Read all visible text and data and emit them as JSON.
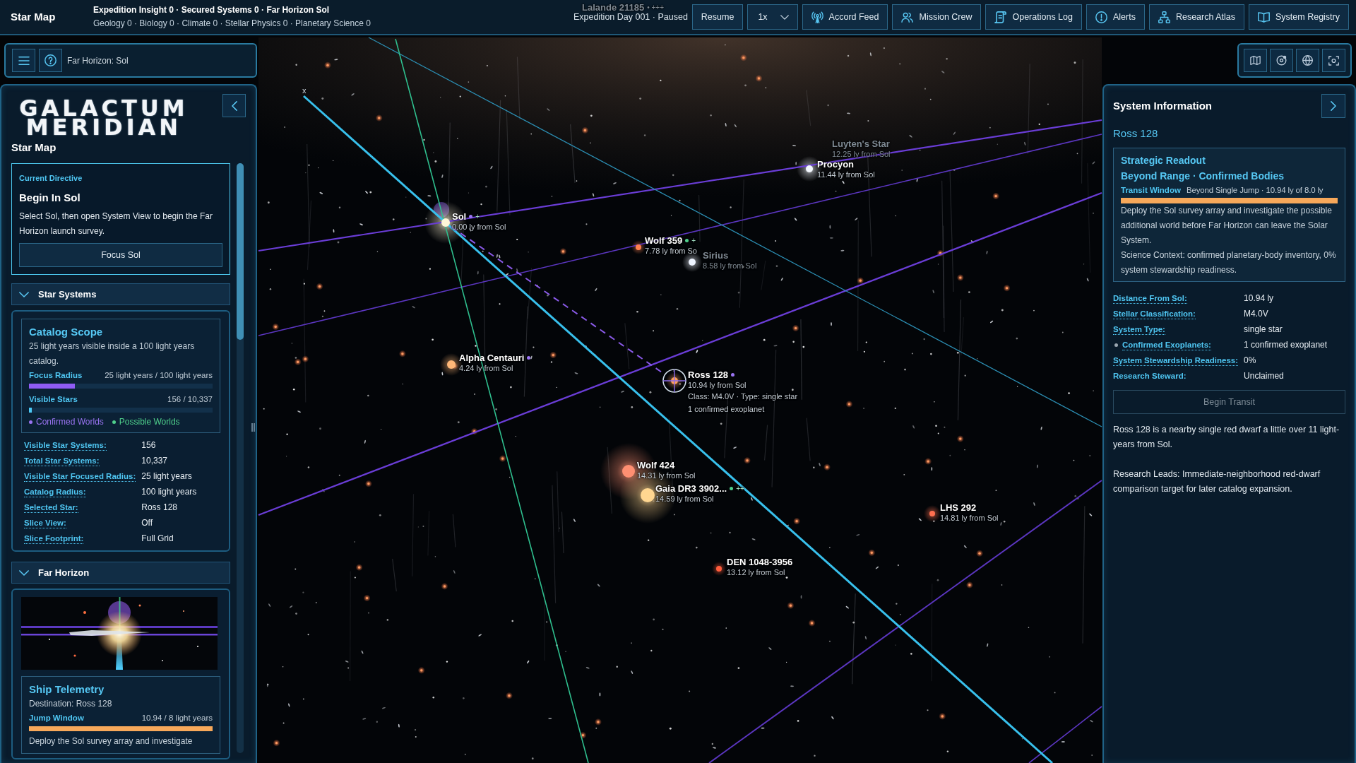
{
  "top_bar": {
    "title": "Star Map",
    "stats": [
      "Expedition Insight 0 · Secured Systems 0 · Far Horizon Sol",
      "Geology 0 · Biology 0 · Climate 0 · Stellar Physics 0 · Planetary Science 0"
    ],
    "status": "Expedition Day 001 · Paused",
    "resume_button": "Resume",
    "speed": {
      "value": "1x"
    },
    "buttons": [
      "Accord Feed",
      "Mission Crew",
      "Operations Log",
      "Alerts",
      "Research Atlas",
      "System Registry"
    ]
  },
  "location_bar": {
    "location": "Far Horizon: Sol"
  },
  "left_panel": {
    "logo": [
      "GALACTUM",
      "MERIDIAN"
    ],
    "heading": "Star Map",
    "directive": {
      "eyebrow": "Current Directive",
      "title": "Begin In Sol",
      "text": "Select Sol, then open System View to begin the Far Horizon launch survey.",
      "button": "Focus Sol"
    },
    "sections": [
      {
        "kind": "catalog",
        "title": "Star Systems",
        "expanded": true,
        "scope": {
          "title": "Catalog Scope",
          "text": "25 light years visible inside a 100 light years catalog.",
          "meters": [
            {
              "label": "Focus Radius",
              "reading": "25 light years / 100 light years",
              "level": 0.25,
              "color": "#8f5cf5"
            },
            {
              "label": "Visible Stars",
              "reading": "156 / 10,337",
              "level": 0.015,
              "color": "#4cc8f4"
            }
          ],
          "legend": [
            {
              "label": "Confirmed Worlds",
              "color": "#9a74f2"
            },
            {
              "label": "Possible Worlds",
              "color": "#4fd08c"
            }
          ]
        },
        "facts": [
          {
            "label": "Visible Star Systems:",
            "value": "156",
            "tooltip": true
          },
          {
            "label": "Total Star Systems:",
            "value": "10,337",
            "tooltip": true
          },
          {
            "label": "Visible Star Focused Radius:",
            "value": "25 light years",
            "tooltip": true
          },
          {
            "label": "Catalog Radius:",
            "value": "100 light years",
            "tooltip": true
          },
          {
            "label": "Selected Star:",
            "value": "Ross 128",
            "tooltip": true
          },
          {
            "label": "Slice View:",
            "value": "Off",
            "tooltip": true
          },
          {
            "label": "Slice Footprint:",
            "value": "Full Grid",
            "tooltip": true
          }
        ]
      },
      {
        "kind": "ship",
        "title": "Far Horizon",
        "expanded": true,
        "telemetry": {
          "title": "Ship Telemetry",
          "destination": "Destination: Ross 128",
          "meter": {
            "label": "Jump Window",
            "reading": "10.94 / 8 light years",
            "level": 1
          },
          "text": "Deploy the Sol survey array and investigate"
        }
      }
    ]
  },
  "map": {
    "axis_label": "x",
    "stars": [
      {
        "name": "Lalande 21185",
        "marks": "• +++",
        "faded": true,
        "selected": false
      },
      {
        "name": "Luyten's Star",
        "distance": "12.25 ly from Sol",
        "faded": true,
        "selected": false
      },
      {
        "name": "Procyon",
        "distance": "11.44 ly from Sol",
        "color": "#f4f8ff",
        "faded": false,
        "selected": false
      },
      {
        "name": "Sol",
        "distance": "0.00 ly from Sol",
        "color": "#fff6d8",
        "dot": {
          "color": "#9a74f2"
        },
        "marks": "+",
        "faded": false,
        "selected": false
      },
      {
        "name": "Wolf 359",
        "distance": "7.78 ly from So",
        "color": "#ff7f4f",
        "dot": {
          "color": "#4fd08c"
        },
        "marks": "+",
        "faded": false,
        "selected": false
      },
      {
        "name": "Sirius",
        "distance": "8.58 ly from Sol",
        "color": "#eef4ff",
        "faded": true,
        "selected": false
      },
      {
        "name": "Alpha Centauri",
        "distance": "4.24 ly from Sol",
        "color": "#ffb878",
        "dot": {
          "color": "#9a74f2"
        },
        "faded": false,
        "selected": false
      },
      {
        "name": "Ross 128",
        "distance": "10.94 ly from Sol",
        "color": "#ff9f5c",
        "dot": {
          "color": "#9a74f2"
        },
        "faded": false,
        "selected": true,
        "details": [
          "Class: M4.0V · Type: single star",
          "1 confirmed exoplanet"
        ]
      },
      {
        "name": "Wolf 424",
        "distance": "14.31 ly from Sol",
        "color": "#ff8f72",
        "faded": false,
        "selected": false
      },
      {
        "name": "Gaia DR3 3902...",
        "distance": "14.59 ly from Sol",
        "color": "#ffd690",
        "dot": {
          "color": "#4fd08c"
        },
        "marks": "++",
        "faded": false,
        "selected": false
      },
      {
        "name": "LHS 292",
        "distance": "14.81 ly from Sol",
        "color": "#ff6f50",
        "faded": false,
        "selected": false
      },
      {
        "name": "DEN 1048-3956",
        "distance": "13.12 ly from Sol",
        "color": "#ff5c3c",
        "faded": false,
        "selected": false
      }
    ]
  },
  "right_panel": {
    "title": "System Information",
    "star": "Ross 128",
    "readout": {
      "title": "Strategic Readout",
      "status": "Beyond Range · Confirmed Bodies",
      "meter": {
        "label": "Transit Window",
        "reading": "Beyond Single Jump · 10.94 ly of 8.0 ly",
        "level": 1
      },
      "paragraphs": [
        "Deploy the Sol survey array and investigate the possible additional world before Far Horizon can leave the Solar System.",
        "Science Context: confirmed planetary-body inventory, 0% system stewardship readiness."
      ]
    },
    "facts": [
      {
        "label": "Distance From Sol:",
        "value": "10.94 ly",
        "tooltip": true,
        "bullet": false
      },
      {
        "label": "Stellar Classification:",
        "value": "M4.0V",
        "tooltip": true,
        "bullet": false
      },
      {
        "label": "System Type:",
        "value": "single star",
        "tooltip": true,
        "bullet": false
      },
      {
        "label": "Confirmed Exoplanets:",
        "value": "1 confirmed exoplanet",
        "tooltip": true,
        "bullet": true
      },
      {
        "label": "System Stewardship Readiness:",
        "value": "0%",
        "tooltip": true,
        "bullet": false
      },
      {
        "label": "Research Steward:",
        "value": "Unclaimed",
        "tooltip": false,
        "bullet": false
      }
    ],
    "transit_button": {
      "label": "Begin Transit",
      "disabled": true
    },
    "description": [
      "Ross 128 is a nearby single red dwarf a little over 11 light-years from Sol.",
      "Research Leads: Immediate-neighborhood red-dwarf comparison target for later catalog expansion."
    ]
  }
}
